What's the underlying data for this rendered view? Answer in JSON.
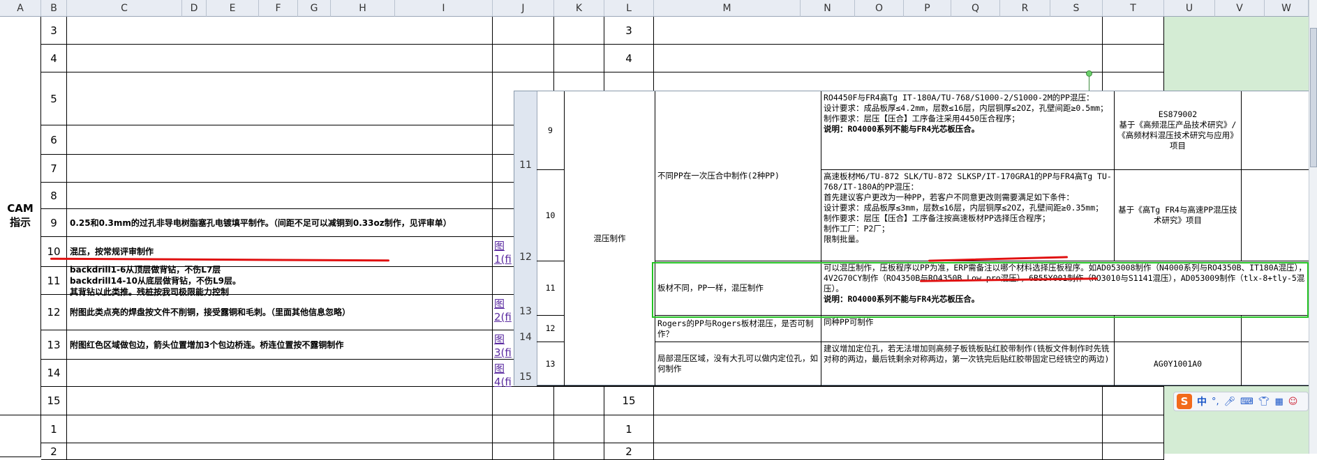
{
  "columns": [
    "A",
    "B",
    "C",
    "D",
    "E",
    "F",
    "G",
    "H",
    "I",
    "J",
    "K",
    "L",
    "M",
    "N",
    "O",
    "P",
    "Q",
    "R",
    "S",
    "T",
    "U",
    "V",
    "W"
  ],
  "sidebar_label": "CAM\n指示",
  "left_rows": [
    {
      "num": "3",
      "text": "",
      "link": ""
    },
    {
      "num": "4",
      "text": "",
      "link": ""
    },
    {
      "num": "5",
      "text": "",
      "link": ""
    },
    {
      "num": "6",
      "text": "",
      "link": ""
    },
    {
      "num": "7",
      "text": "",
      "link": ""
    },
    {
      "num": "8",
      "text": "",
      "link": ""
    },
    {
      "num": "9",
      "text": "0.25和0.3mm的过孔非导电树脂塞孔电镀填平制作。（间距不足可以减铜到0.33oz制作，见评审单）",
      "link": ""
    },
    {
      "num": "10",
      "text": "混压，按常规评审制作",
      "link": "图\n1(fi"
    },
    {
      "num": "11",
      "text": "backdrill1-6从顶层做背钻，不伤L7层\nbackdrill14-10从底层做背钻，不伤L9层。\n其背钻以此类推。残桩按我司极限能力控制",
      "link": ""
    },
    {
      "num": "12",
      "text": "附图此类点亮的焊盘按文件不削铜，接受露铜和毛刺。（里面其他信息忽略）",
      "link": "图\n2(fi"
    },
    {
      "num": "13",
      "text": "附图红色区域做包边，箭头位置增加3个包边桥连。桥连位置按不露铜制作",
      "link": "图\n3(fi"
    },
    {
      "num": "14",
      "text": "",
      "link": "图\n4(fi"
    },
    {
      "num": "15",
      "text": "",
      "link": ""
    },
    {
      "num": "1",
      "text": "",
      "link": ""
    },
    {
      "num": "2",
      "text": "",
      "link": ""
    }
  ],
  "right_rows": [
    "3",
    "4",
    "",
    "",
    "",
    "",
    "",
    "",
    "",
    "",
    "",
    "",
    "15",
    "1",
    "2"
  ],
  "embedded": {
    "row_headers": [
      "11",
      "12",
      "13",
      "14",
      "15"
    ],
    "group_label": "混压制作",
    "rows": [
      {
        "no": "9",
        "issue": "不同PP在一次压合中制作(2种PP)",
        "method": "RO4450F与FR4高Tg IT-180A/TU-768/S1000-2/S1000-2M的PP混压：\n设计要求：成品板厚≤4.2mm，层数≤16层，内层铜厚≤2OZ，孔壁间距≥0.5mm；\n制作要求：层压【压合】工序备注采用4450压合程序；",
        "note": "说明：RO4000系列不能与FR4光芯板压合。",
        "ref": "ES879002\n基于《高频混压产品技术研究》/《高频材料混压技术研究与应用》项目"
      },
      {
        "no": "10",
        "issue": "",
        "method": "高速板材M6/TU-872 SLK/TU-872 SLKSP/IT-170GRA1的PP与FR4高Tg TU-768/IT-180A的PP混压：\n首先建议客户更改为一种PP，若客户不同意更改则需要满足如下条件：\n设计要求：成品板厚≤3mm，层数≤16层，内层铜厚≤2OZ，孔壁间距≥0.35mm；\n制作要求：层压【压合】工序备注按高速板材PP选择压合程序；\n制作工厂：P2厂；\n限制批量。",
        "note": "",
        "ref": "基于《高Tg FR4与高速PP混压技术研究》项目"
      },
      {
        "no": "11",
        "issue": "板材不同，PP一样，混压制作",
        "method": "可以混压制作，压板程序以PP为准，ERP需备注以哪个材料选择压板程序。如AD053008制作（N4000系列与RO4350B、IT180A混压），4V2G70CY制作（RO4350B与RO4350B Low pro混压），6B55Y001制作（RO3010与S1141混压），AD053009制作（tlx-8+tly-5混压）。",
        "note": "说明：RO4000系列不能与FR4光芯板压合。",
        "ref": ""
      },
      {
        "no": "12",
        "issue": "Rogers的PP与Rogers板材混压，是否可制作？",
        "method": "同种PP可制作",
        "note": "",
        "ref": ""
      },
      {
        "no": "13",
        "issue": "局部混压区域，没有大孔可以做内定位孔，如何制作",
        "method": "建议增加定位孔，若无法增加则高频子板铣板贴红胶带制作(铣板文件制作时先铣对称的两边，最后铣剩余对称两边，第一次铣完后贴红胶带固定已经铣空的两边)",
        "note": "",
        "ref": "AG0Y1001A0"
      }
    ]
  },
  "ime_toolbar": {
    "logo": "S",
    "lang": "中"
  },
  "colors": {
    "accent_red": "#e01010",
    "highlight_green": "#22c022",
    "sheet_green": "#d4ecd4"
  }
}
